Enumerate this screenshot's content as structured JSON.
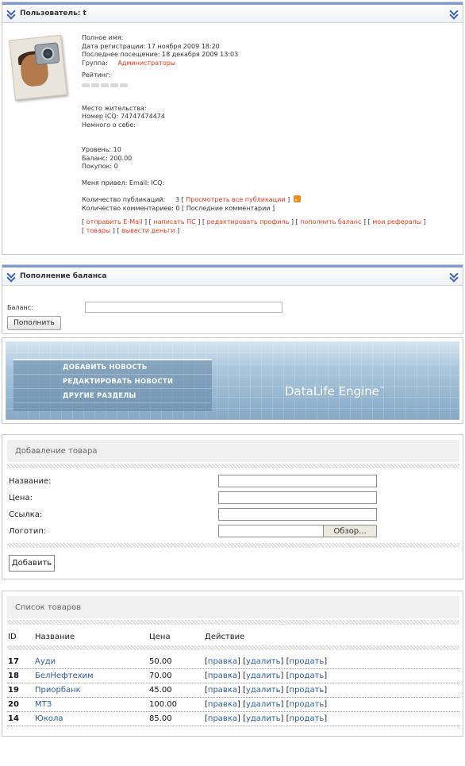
{
  "profile": {
    "title": "Пользователь: t",
    "full_name_label": "Полное имя:",
    "reg_date": "Дата регистрации: 17 ноября 2009 18:20",
    "last_visit": "Последнее посещение: 18 декабря 2009 13:03",
    "group_label": "Группа:",
    "group_value": "Администраторы",
    "rating_label": "Рейтинг:",
    "location": "Место жительства:",
    "icq": "Номер ICQ: 74747474474",
    "about": "Немного о себе:",
    "level": "Уровень: 10",
    "balance": "Баланс: 200.00",
    "purchases": "Покупок: 0",
    "referrer": "Меня привел: Email: ICQ:",
    "publications_label": "Количество публикаций:",
    "publications_count": "3",
    "view_all": "Просмотреть все публикации",
    "comments_label": "Количество комментариев: 0",
    "last_comments": "Последние комментарии",
    "actions": [
      "отправить E-Mail",
      "написать ПС",
      "редактировать профиль",
      "пополнить баланс",
      "мои рефералы",
      "товары",
      "вывести деньги"
    ]
  },
  "balance_panel": {
    "title": "Пополнение баланса",
    "label": "Баланс:",
    "input_value": "",
    "button": "Пополнить"
  },
  "banner": {
    "menu": [
      "ДОБАВИТЬ НОВОСТЬ",
      "РЕДАКТИРОВАТЬ НОВОСТИ",
      "ДРУГИЕ РАЗДЕЛЫ"
    ],
    "brand": "DataLife Engine",
    "tm": "™"
  },
  "add_product": {
    "title": "Добавление товара",
    "fields": [
      {
        "label": "Название:",
        "value": ""
      },
      {
        "label": "Цена:",
        "value": ""
      },
      {
        "label": "Ссылка:",
        "value": ""
      },
      {
        "label": "Логотип:",
        "value": ""
      }
    ],
    "browse": "Обзор...",
    "submit": "Добавить"
  },
  "product_list": {
    "title": "Список товаров",
    "columns": [
      "ID",
      "Название",
      "Цена",
      "Действие"
    ],
    "rows": [
      {
        "id": "17",
        "name": "Ауди",
        "price": "50.00"
      },
      {
        "id": "18",
        "name": "БелНефтехим",
        "price": "70.00"
      },
      {
        "id": "19",
        "name": "Приорбанк",
        "price": "45.00"
      },
      {
        "id": "20",
        "name": "МТЗ",
        "price": "100.00"
      },
      {
        "id": "14",
        "name": "Юкола",
        "price": "85.00"
      }
    ],
    "actions": {
      "edit": "правка",
      "delete": "удалить",
      "sell": "продать"
    }
  }
}
